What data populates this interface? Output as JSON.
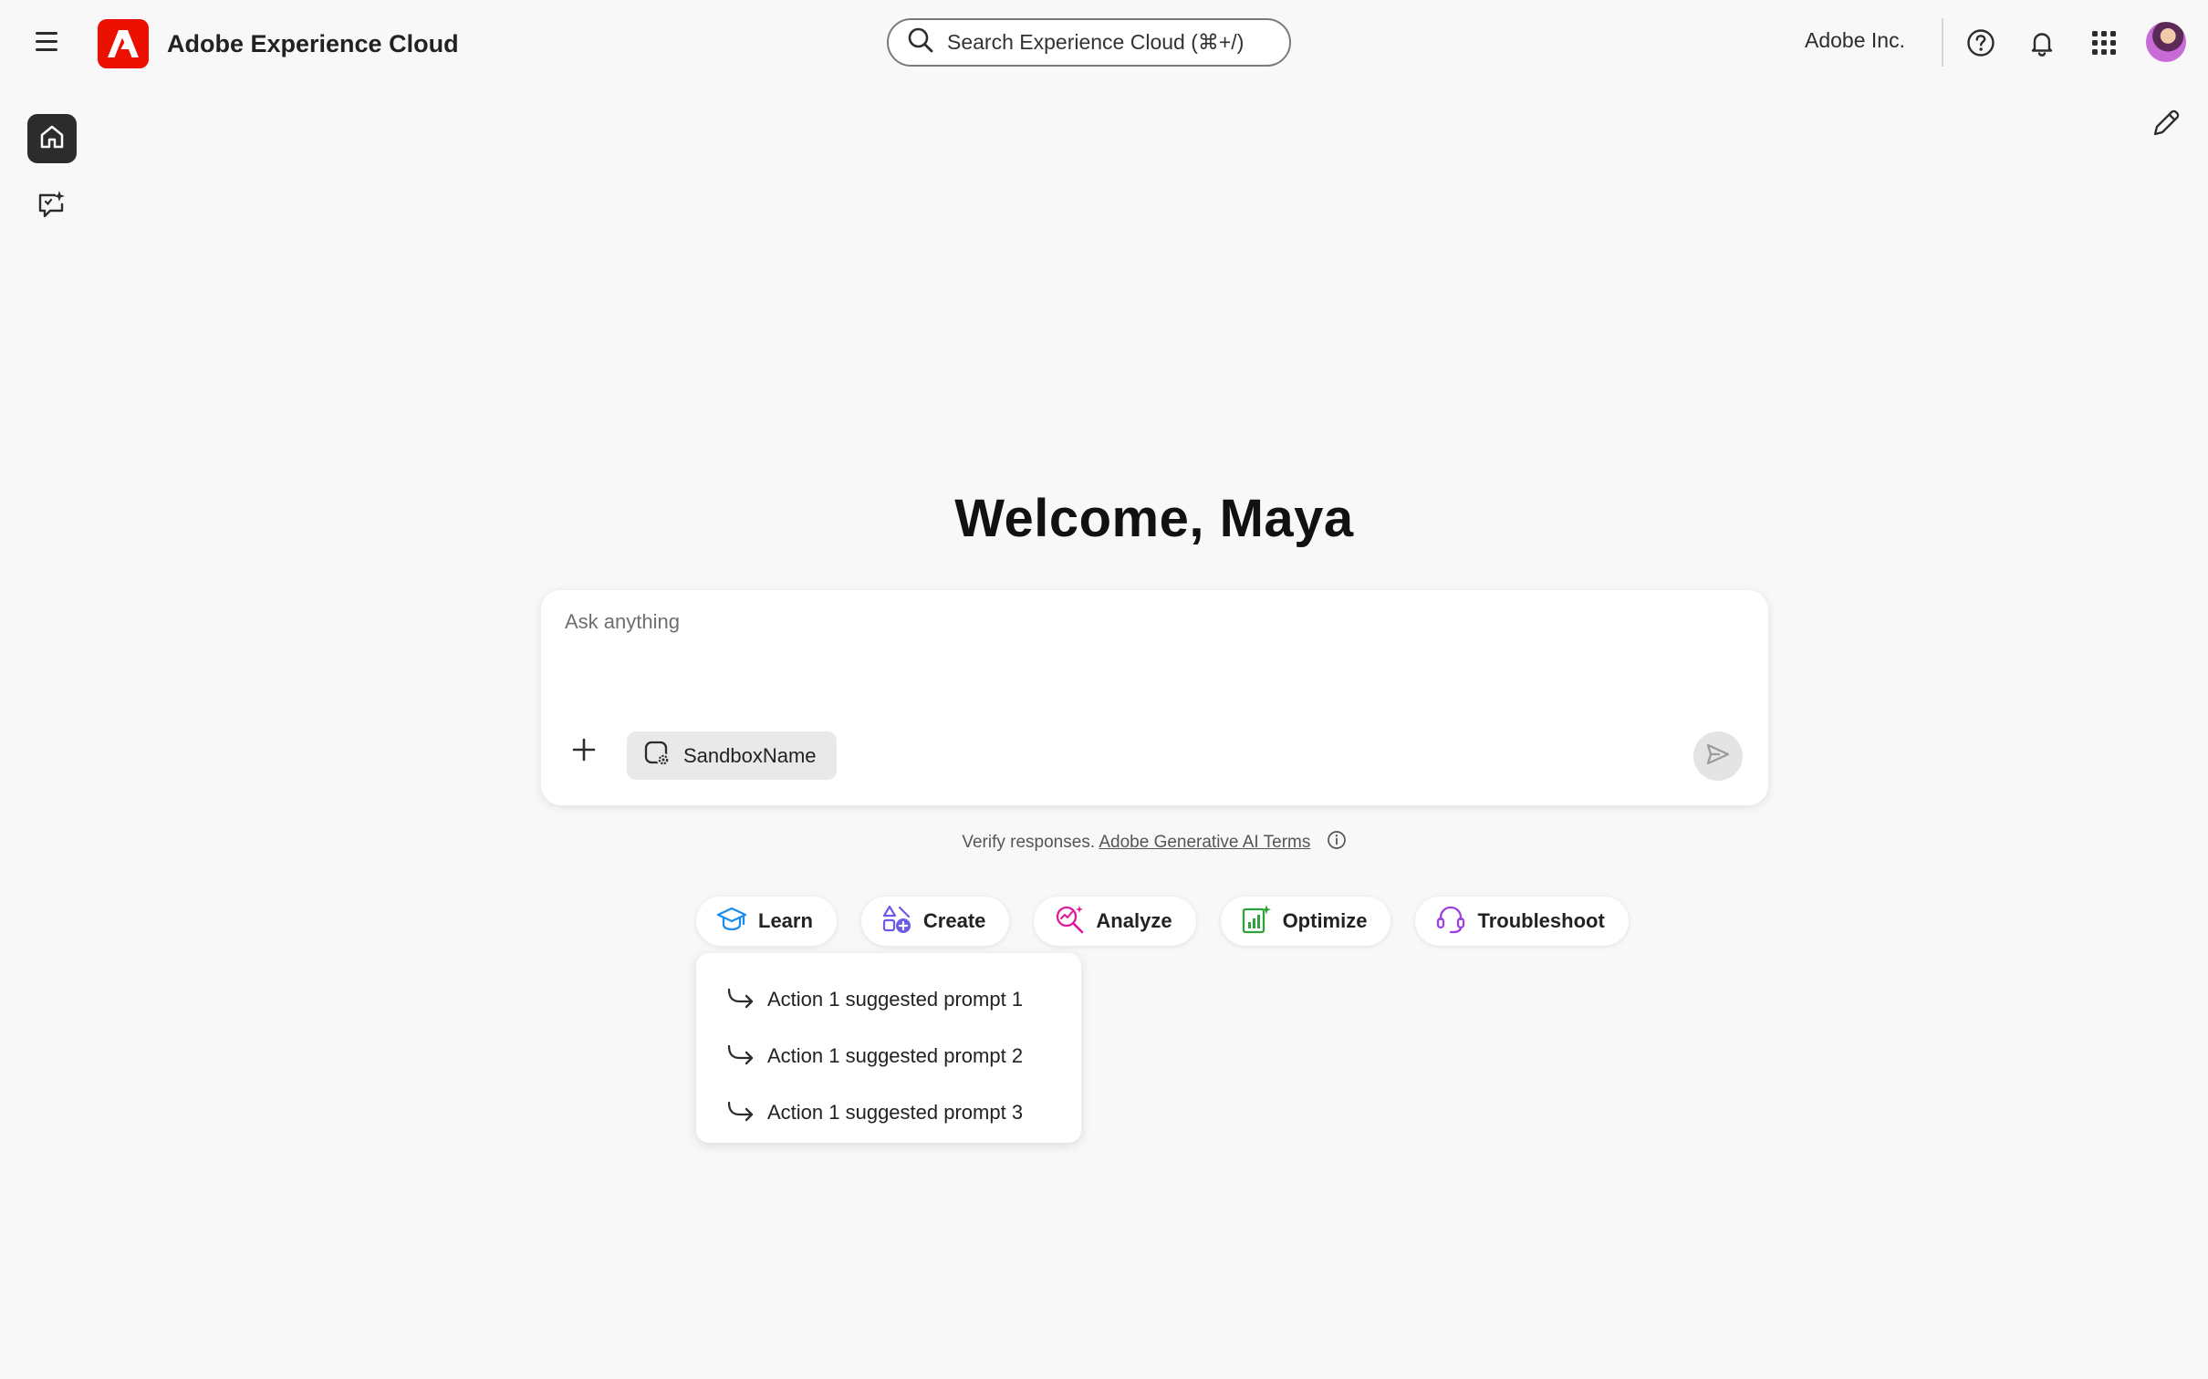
{
  "header": {
    "app_title": "Adobe Experience Cloud",
    "search_placeholder": "Search Experience Cloud (⌘+/)",
    "org_name": "Adobe Inc.",
    "icons": [
      "menu-icon",
      "adobe-logo",
      "search-icon",
      "help-icon",
      "bell-icon",
      "apps-grid-icon",
      "avatar"
    ]
  },
  "rail": {
    "items": [
      {
        "icon": "home-icon",
        "active": true
      },
      {
        "icon": "chat-sparkle-icon",
        "active": false
      }
    ]
  },
  "main": {
    "welcome": "Welcome, Maya",
    "prompt_placeholder": "Ask anything",
    "sandbox_label": "SandboxName",
    "verify_text": "Verify responses.",
    "terms_link": "Adobe Generative AI Terms"
  },
  "actions": [
    {
      "label": "Learn",
      "icon": "graduation-cap-icon",
      "color": "#1a8cf0"
    },
    {
      "label": "Create",
      "icon": "create-shapes-icon",
      "color": "#6b5ce7"
    },
    {
      "label": "Analyze",
      "icon": "analyze-magnifier-icon",
      "color": "#e0189a"
    },
    {
      "label": "Optimize",
      "icon": "optimize-chart-icon",
      "color": "#2fa23c"
    },
    {
      "label": "Troubleshoot",
      "icon": "headset-icon",
      "color": "#9b3fe0"
    }
  ],
  "suggestions": [
    "Action 1 suggested prompt 1",
    "Action 1 suggested prompt 2",
    "Action 1 suggested prompt 3"
  ],
  "colors": {
    "brand_red": "#eb1000",
    "background": "#f8f8f8",
    "active_rail": "#2c2c2c"
  }
}
